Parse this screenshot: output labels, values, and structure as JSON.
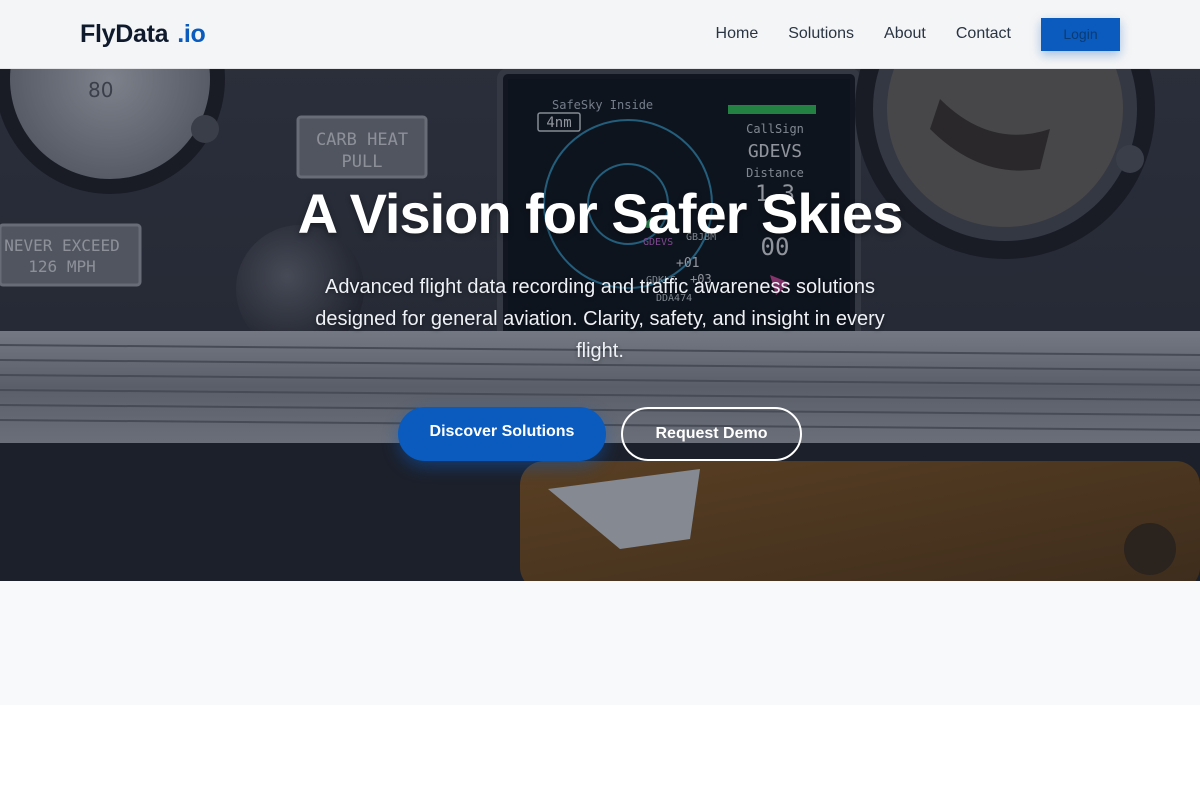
{
  "header": {
    "logo_main": "FlyData",
    "logo_suffix": ".io",
    "nav": [
      "Home",
      "Solutions",
      "About",
      "Contact"
    ],
    "login_label": "Login"
  },
  "hero": {
    "title": "A Vision for Safer Skies",
    "subtitle": "Advanced flight data recording and traffic awareness solutions designed for general aviation. Clarity, safety, and insight in every flight.",
    "primary_cta": "Discover Solutions",
    "secondary_cta": "Request Demo",
    "background": {
      "placards": [
        "CARB HEAT",
        "PULL",
        "NEVER EXCEED",
        "126 MPH"
      ],
      "gauge_number": "80",
      "display": {
        "header": "SafeSky Inside",
        "range": "4nm",
        "callsign_label": "CallSign",
        "callsign": "GDEVS",
        "distance_label": "Distance",
        "distance": "1.3",
        "vert_value": "00",
        "target_labels": [
          "GDEVS",
          "GBJBM",
          "+01",
          "GDKLS",
          "+03",
          "DDA474"
        ]
      }
    }
  },
  "colors": {
    "brand": "#0a5bbd",
    "text_dark": "#0f1b2d",
    "nav_text": "#2a3443",
    "light_section": "#f8f9fb"
  }
}
